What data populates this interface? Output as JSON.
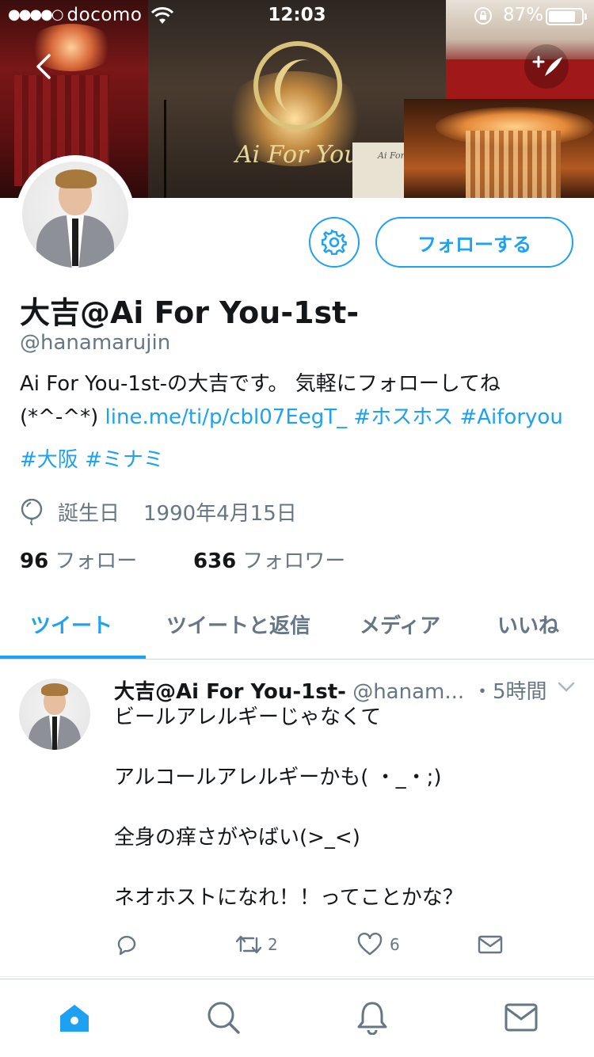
{
  "status_bar": {
    "carrier": "docomo",
    "signal_dots": "●●●●○",
    "time": "12:03",
    "battery_percent": "87%",
    "battery_level": 0.87
  },
  "banner": {
    "logo_text": "Ai For You",
    "sign_text": "Ai For You"
  },
  "profile": {
    "follow_button": "フォローする",
    "display_name": "大吉@Ai For You-1st-",
    "handle": "@hanamarujin",
    "bio": {
      "text1": "Ai For You-1st-の大吉です。 気軽にフォローしてね",
      "text2": "(*^-^*) ",
      "link": "line.me/ti/p/cbl07EegT_",
      "tag1": "#ホスホス",
      "tag2": "#Aiforyou",
      "tag3": "#大阪",
      "tag4": "#ミナミ"
    },
    "birthday_label": "誕生日",
    "birthday_date": "1990年4月15日",
    "following_count": "96",
    "following_label": "フォロー",
    "followers_count": "636",
    "followers_label": "フォロワー"
  },
  "tabs": [
    {
      "label": "ツイート",
      "active": true
    },
    {
      "label": "ツイートと返信",
      "active": false
    },
    {
      "label": "メディア",
      "active": false
    },
    {
      "label": "いいね",
      "active": false
    }
  ],
  "tweet": {
    "name": "大吉@Ai For You-1st-",
    "handle": "@hanam...",
    "time": "・5時間",
    "lines": [
      "ビールアレルギーじゃなくて",
      "アルコールアレルギーかも( ・_・;)",
      "全身の痒さがやばい(>_<)",
      "ネオホストになれ！！ってことかな？"
    ],
    "retweet_count": "2",
    "like_count": "6"
  },
  "colors": {
    "accent": "#1da1f2",
    "secondary_text": "#657786",
    "primary_text": "#14171a"
  },
  "icons": [
    "back-icon",
    "compose-icon",
    "gear-icon",
    "balloon-icon",
    "chevron-down-icon",
    "reply-icon",
    "retweet-icon",
    "like-icon",
    "message-icon",
    "home-icon",
    "search-icon",
    "notifications-icon",
    "mail-icon"
  ]
}
